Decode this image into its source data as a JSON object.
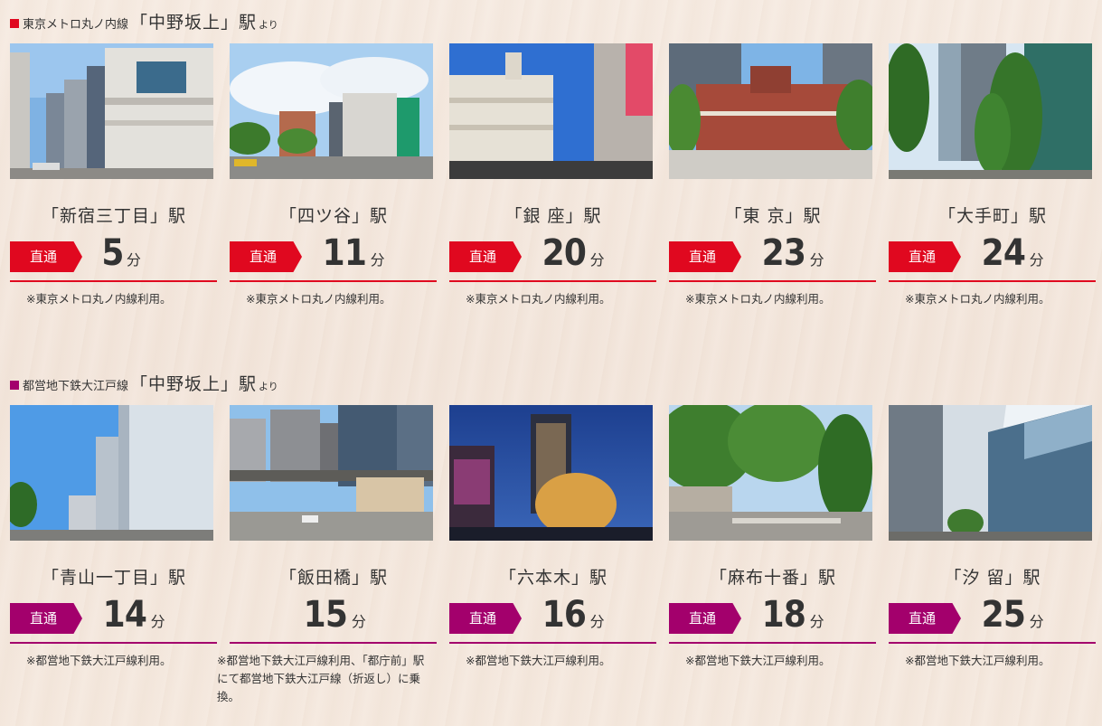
{
  "colors": {
    "metro": "#e0081f",
    "oedo": "#a3006c"
  },
  "sections": [
    {
      "line": "東京メトロ丸ノ内線",
      "station": "「中野坂上」駅",
      "from": "より",
      "direct": "直通",
      "cards": [
        {
          "name": "「新宿三丁目」駅",
          "minutes": "5",
          "unit": "分",
          "note": "※東京メトロ丸ノ内線利用。"
        },
        {
          "name": "「四ツ谷」駅",
          "minutes": "11",
          "unit": "分",
          "note": "※東京メトロ丸ノ内線利用。"
        },
        {
          "name": "「銀 座」駅",
          "minutes": "20",
          "unit": "分",
          "note": "※東京メトロ丸ノ内線利用。"
        },
        {
          "name": "「東 京」駅",
          "minutes": "23",
          "unit": "分",
          "note": "※東京メトロ丸ノ内線利用。"
        },
        {
          "name": "「大手町」駅",
          "minutes": "24",
          "unit": "分",
          "note": "※東京メトロ丸ノ内線利用。"
        }
      ]
    },
    {
      "line": "都営地下鉄大江戸線",
      "station": "「中野坂上」駅",
      "from": "より",
      "direct": "直通",
      "cards": [
        {
          "name": "「青山一丁目」駅",
          "minutes": "14",
          "unit": "分",
          "note": "※都営地下鉄大江戸線利用。"
        },
        {
          "name": "「飯田橋」駅",
          "minutes": "15",
          "unit": "分",
          "note": "※都営地下鉄大江戸線利用、「都庁前」駅にて都営地下鉄大江戸線（折返し）に乗換。"
        },
        {
          "name": "「六本木」駅",
          "minutes": "16",
          "unit": "分",
          "note": "※都営地下鉄大江戸線利用。"
        },
        {
          "name": "「麻布十番」駅",
          "minutes": "18",
          "unit": "分",
          "note": "※都営地下鉄大江戸線利用。"
        },
        {
          "name": "「汐 留」駅",
          "minutes": "25",
          "unit": "分",
          "note": "※都営地下鉄大江戸線利用。"
        }
      ]
    }
  ]
}
